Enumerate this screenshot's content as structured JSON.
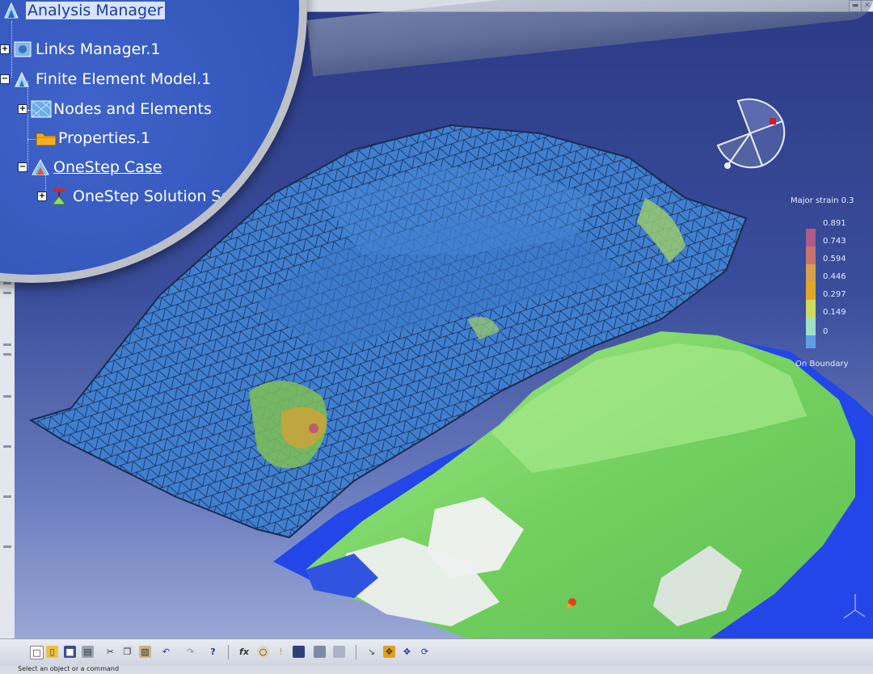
{
  "window": {
    "minimize_glyph": "▬",
    "close_glyph": "✕"
  },
  "tree": {
    "root": {
      "label": "Analysis Manager",
      "icon": "analysis-manager-icon"
    },
    "items": [
      {
        "label": "Links Manager.1",
        "icon": "links-manager-icon",
        "expander": "+"
      },
      {
        "label": "Finite Element Model.1",
        "icon": "fem-icon",
        "expander": "−"
      },
      {
        "label": "Nodes and Elements",
        "icon": "mesh-icon",
        "expander": "+"
      },
      {
        "label": "Properties.1",
        "icon": "folder-icon"
      },
      {
        "label": "OneStep Case",
        "icon": "case-icon",
        "expander": "−"
      },
      {
        "label": "OneStep Solution Set",
        "icon": "solution-set-icon",
        "expander": "+"
      }
    ]
  },
  "legend": {
    "title": "Major strain 0.3",
    "values": [
      "0.891",
      "0.743",
      "0.594",
      "0.446",
      "0.297",
      "0.149",
      "0"
    ],
    "colors": [
      "#b15a86",
      "#c9736d",
      "#d8a04a",
      "#e0a82a",
      "#cfd95a",
      "#9fe0c6",
      "#5f9ee6"
    ],
    "footer": "On Boundary"
  },
  "toolbar": {
    "icons": [
      "new-icon",
      "open-icon",
      "save-icon",
      "print-icon",
      "cut-icon",
      "copy-icon",
      "paste-icon",
      "undo-icon",
      "redo-icon",
      "whats-this-icon",
      "formula-icon",
      "knowledge-icon",
      "info-icon",
      "catalog-icon",
      "properties-icon",
      "layers-icon",
      "fly-icon",
      "fit-all-icon",
      "pan-icon",
      "rotate-icon"
    ],
    "labels": [
      "fx"
    ]
  },
  "status": {
    "text": "Select an object or a command"
  },
  "colors": {
    "viewport": "#2c3b86",
    "mesh": "#3f7fd0",
    "mesh_line": "#1b2b52",
    "green_part": "#7ed66a",
    "blue_flange": "#2346e8"
  }
}
